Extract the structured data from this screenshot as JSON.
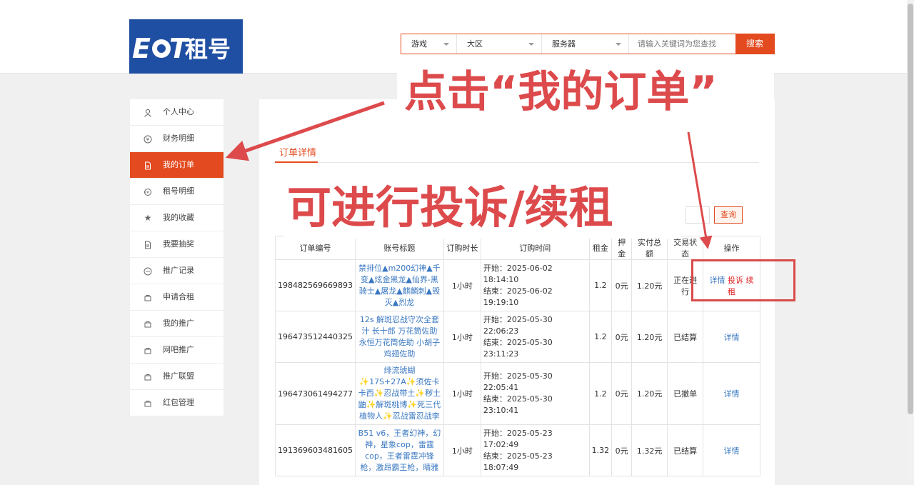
{
  "header": {
    "logo_text": "EOT 租号",
    "search": {
      "game_label": "游戏",
      "region_label": "大区",
      "server_label": "服务器",
      "keyword_placeholder": "请输入关键词为您查找",
      "button_label": "搜索"
    }
  },
  "sidebar": {
    "items": [
      {
        "label": "个人中心",
        "icon": "user-icon",
        "active": false
      },
      {
        "label": "财务明细",
        "icon": "money-icon",
        "active": false
      },
      {
        "label": "我的订单",
        "icon": "document-icon",
        "active": true
      },
      {
        "label": "租号明细",
        "icon": "rent-icon",
        "active": false
      },
      {
        "label": "我的收藏",
        "icon": "star-icon",
        "active": false
      },
      {
        "label": "我要抽奖",
        "icon": "document-icon",
        "active": false
      },
      {
        "label": "推广记录",
        "icon": "chat-icon",
        "active": false
      },
      {
        "label": "申请合租",
        "icon": "bag-icon",
        "active": false
      },
      {
        "label": "我的推广",
        "icon": "bag-icon",
        "active": false
      },
      {
        "label": "网吧推广",
        "icon": "bag-icon",
        "active": false
      },
      {
        "label": "推广联盟",
        "icon": "bag-icon",
        "active": false
      },
      {
        "label": "红包管理",
        "icon": "bag-icon",
        "active": false
      }
    ]
  },
  "main": {
    "tab_title": "订单详情",
    "query_button": "查询",
    "table": {
      "headers": [
        "订单编号",
        "账号标题",
        "订购时长",
        "订购时间",
        "租金",
        "押金",
        "实付总额",
        "交易状态",
        "操作"
      ],
      "rows": [
        {
          "order_id": "198482569669893",
          "title": "禁排位▲m200幻神▲千变▲炫金黑龙▲仙界-黑骑士▲屠龙▲麒麟刺▲毁灭▲烈龙",
          "duration": "1小时",
          "start": "开始：2025-06-02 18:14:10",
          "end": "结束：2025-06-02 19:19:10",
          "rent": "1.2",
          "deposit": "0元",
          "total": "1.20元",
          "status": "正在进行",
          "actions": [
            "详情",
            "投诉",
            "续租"
          ]
        },
        {
          "order_id": "196473512440325",
          "title": "12s 解斑忍战守次全套 汁 长十郎 万花筒佐助 永恒万花筒佐助 小胡子 鸡翅佐助",
          "duration": "1小时",
          "start": "开始：2025-05-30 22:06:23",
          "end": "结束：2025-05-30 23:11:23",
          "rent": "1.2",
          "deposit": "0元",
          "total": "1.20元",
          "status": "已结算",
          "actions": [
            "详情"
          ]
        },
        {
          "order_id": "196473061494277",
          "title": "绯流琥蝴✨17S+27A✨须佐卡卡西✨忍战带土✨秽土鼬✨解斑桃博✨死三代植物人✨忍战雷忍战李",
          "duration": "1小时",
          "start": "开始：2025-05-30 22:05:41",
          "end": "结束：2025-05-30 23:10:41",
          "rent": "1.2",
          "deposit": "0元",
          "total": "1.20元",
          "status": "已撤单",
          "actions": [
            "详情"
          ]
        },
        {
          "order_id": "191369603481605",
          "title": "B51 v6，王者幻神，幻神，星象cop，雷霆cop，王者雷霆冲锋枪，激昂霸王枪，晴雅",
          "duration": "1小时",
          "start": "开始：2025-05-23 17:02:49",
          "end": "结束：2025-05-23 18:07:49",
          "rent": "1.32",
          "deposit": "0元",
          "total": "1.32元",
          "status": "已结算",
          "actions": [
            "详情"
          ]
        }
      ]
    }
  },
  "annotations": {
    "click_orders": "点击“我的订单”",
    "complain_renew": "可进行投诉/续租"
  },
  "colors": {
    "accent": "#e34a1f",
    "annotation": "#dd4a4c",
    "link": "#3a78c2"
  }
}
